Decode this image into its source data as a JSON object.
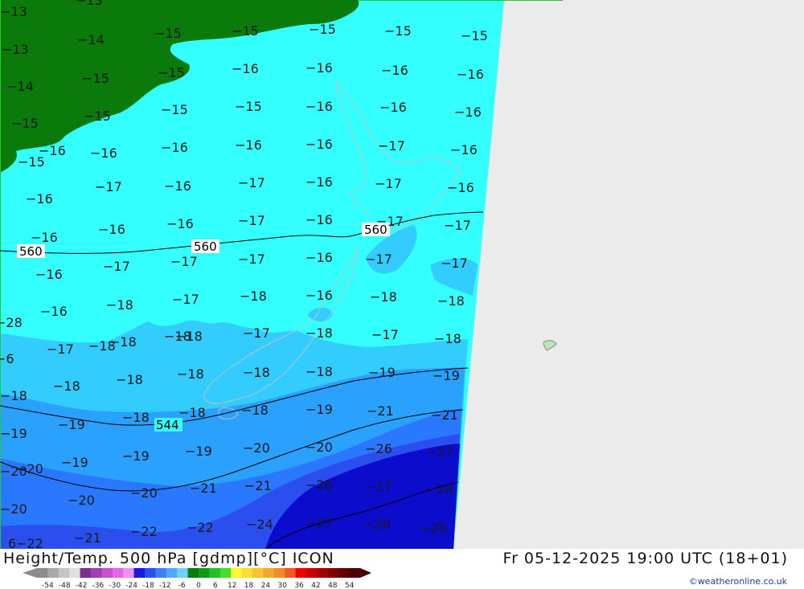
{
  "title": "Height/Temp. 500 hPa [gdmp][°C] ICON",
  "valid_time": "Fr 05-12-2025 19:00 UTC (18+01)",
  "credit": "©weatheronline.co.uk",
  "legend": {
    "ticks": [
      "-54",
      "-48",
      "-42",
      "-36",
      "-30",
      "-24",
      "-18",
      "-12",
      "-6",
      "0",
      "6",
      "12",
      "18",
      "24",
      "30",
      "36",
      "42",
      "48",
      "54"
    ],
    "colors": [
      "#8c8c8c",
      "#a8a8a8",
      "#c4c4c4",
      "#e0e0e0",
      "#7a2f8f",
      "#a13db3",
      "#c94fd1",
      "#e466e8",
      "#f291f5",
      "#1a1adc",
      "#2e4fee",
      "#3f80f5",
      "#52a8fb",
      "#6fd0ff",
      "#0a7a0a",
      "#109c10",
      "#22c022",
      "#44dd30",
      "#fafa30",
      "#f8e030",
      "#f6c430",
      "#f4a730",
      "#f28a2a",
      "#ee5a20",
      "#ee0000",
      "#c40000",
      "#a00000",
      "#800000",
      "#640000",
      "#4a0000"
    ]
  },
  "contours": [
    {
      "value": "560"
    },
    {
      "value": "560"
    },
    {
      "value": "544"
    }
  ],
  "temperature_labels": [
    "-13",
    "-13",
    "-13",
    "-14",
    "-14",
    "-15",
    "-15",
    "-15",
    "-15",
    "-15",
    "-15",
    "-15",
    "-15",
    "-15",
    "-15",
    "-15",
    "-15",
    "-16",
    "-16",
    "-16",
    "-16",
    "-16",
    "-16",
    "-16",
    "-16",
    "-16",
    "-16",
    "-16",
    "-16",
    "-16",
    "-16",
    "-16",
    "-16",
    "-16",
    "-16",
    "-16",
    "-16",
    "-16",
    "-16",
    "-16",
    "-16",
    "-16",
    "-17",
    "-17",
    "-17",
    "-17",
    "-17",
    "-17",
    "-17",
    "-17",
    "-17",
    "-17",
    "-17",
    "-17",
    "-17",
    "-17",
    "-17",
    "-17",
    "-18",
    "-18",
    "-18",
    "-18",
    "-18",
    "-18",
    "-18",
    "-18",
    "-18",
    "-18",
    "-18",
    "-18",
    "-18",
    "-18",
    "-18",
    "-18",
    "-18",
    "-18",
    "-18",
    "-19",
    "-19",
    "-19",
    "-19",
    "-19",
    "-19",
    "-19",
    "-19",
    "-20",
    "-20",
    "-20",
    "-20",
    "-20",
    "-20",
    "-20",
    "-21",
    "-21",
    "-21",
    "-21",
    "-21",
    "-22",
    "-22",
    "-22",
    "-24",
    "-26",
    "-26",
    "-27",
    "-27",
    "-27",
    "-28",
    "-28",
    "-28",
    "-28",
    "-6",
    "6",
    "-22"
  ]
}
